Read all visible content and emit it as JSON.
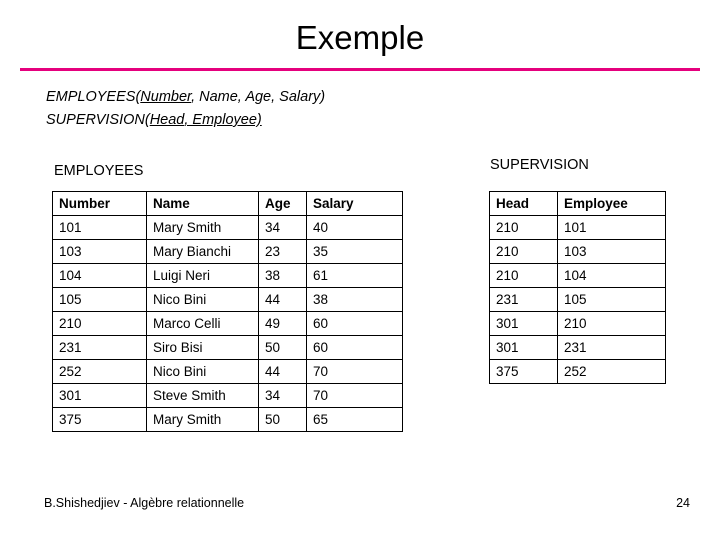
{
  "slide": {
    "title": "Exemple",
    "accent_color": "#e5007d",
    "schema": {
      "line1_prefix": "EMPLOYEES(",
      "line1_key": "Number",
      "line1_rest": ", Name, Age, Salary)",
      "line2_prefix": "SUPERVISION(",
      "line2_key": "Head",
      "line2_rest": ", Employee)"
    },
    "captions": {
      "employees": "EMPLOYEES",
      "supervision": "SUPERVISION"
    },
    "footer": {
      "left": "B.Shishedjiev - Algèbre relationnelle",
      "page": "24"
    }
  },
  "employees_table": {
    "headers": [
      "Number",
      "Name",
      "Age",
      "Salary"
    ],
    "rows": [
      [
        "101",
        "Mary Smith",
        "34",
        "40"
      ],
      [
        "103",
        "Mary Bianchi",
        "23",
        "35"
      ],
      [
        "104",
        "Luigi Neri",
        "38",
        "61"
      ],
      [
        "105",
        "Nico Bini",
        "44",
        "38"
      ],
      [
        "210",
        "Marco Celli",
        "49",
        "60"
      ],
      [
        "231",
        "Siro Bisi",
        "50",
        "60"
      ],
      [
        "252",
        "Nico Bini",
        "44",
        "70"
      ],
      [
        "301",
        "Steve Smith",
        "34",
        "70"
      ],
      [
        "375",
        "Mary Smith",
        "50",
        "65"
      ]
    ]
  },
  "supervision_table": {
    "headers": [
      "Head",
      "Employee"
    ],
    "rows": [
      [
        "210",
        "101"
      ],
      [
        "210",
        "103"
      ],
      [
        "210",
        "104"
      ],
      [
        "231",
        "105"
      ],
      [
        "301",
        "210"
      ],
      [
        "301",
        "231"
      ],
      [
        "375",
        "252"
      ]
    ]
  }
}
